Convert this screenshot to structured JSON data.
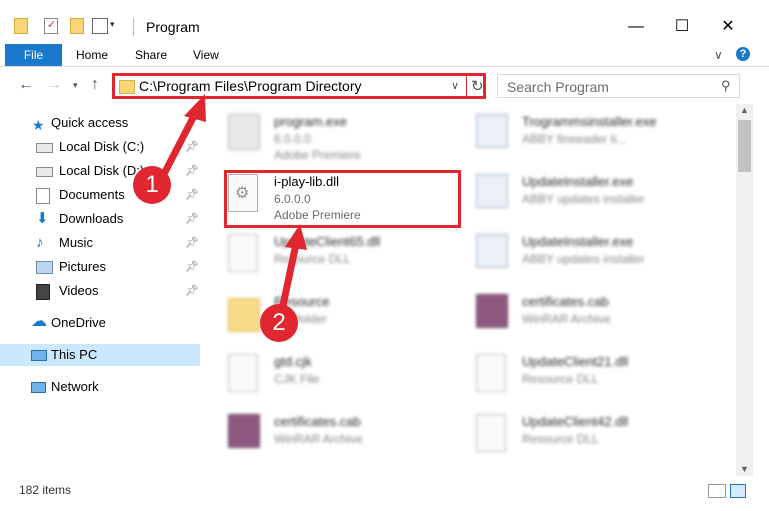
{
  "window": {
    "title": "Program",
    "minimize": "—",
    "maximize": "☐",
    "close": "✕"
  },
  "ribbon": {
    "tabs": [
      "File",
      "Home",
      "Share",
      "View"
    ],
    "help": "?",
    "collapse": "∨"
  },
  "nav": {
    "address": "C:\\Program Files\\Program Directory",
    "search_placeholder": "Search Program"
  },
  "sidebar": {
    "items": [
      {
        "label": "Quick access",
        "icon": "star-icon"
      },
      {
        "label": "Local Disk (C:)",
        "icon": "drive-icon",
        "pinned": true
      },
      {
        "label": "Local Disk (D:)",
        "icon": "drive-icon",
        "pinned": true
      },
      {
        "label": "Documents",
        "icon": "documents-icon",
        "pinned": true
      },
      {
        "label": "Downloads",
        "icon": "downloads-icon",
        "pinned": true
      },
      {
        "label": "Music",
        "icon": "music-icon",
        "pinned": true
      },
      {
        "label": "Pictures",
        "icon": "pictures-icon",
        "pinned": true
      },
      {
        "label": "Videos",
        "icon": "videos-icon",
        "pinned": true
      },
      {
        "label": "OneDrive",
        "icon": "cloud-icon"
      },
      {
        "label": "This PC",
        "icon": "pc-icon",
        "selected": true
      },
      {
        "label": "Network",
        "icon": "network-icon"
      }
    ]
  },
  "files": {
    "left": [
      {
        "name": "program.exe",
        "line1": "6.0.0.0",
        "line2": "Adobe Premiere",
        "icon": "exe-icon"
      },
      {
        "name": "i-play-lib.dll",
        "line1": "6.0.0.0",
        "line2": "Adobe Premiere",
        "icon": "dll-gear-icon"
      },
      {
        "name": "UpdateClient65.dll",
        "line1": "Resource DLL",
        "line2": "",
        "icon": "dll-gear-icon"
      },
      {
        "name": "Resource",
        "line1": "File folder",
        "line2": "",
        "icon": "folder-icon"
      },
      {
        "name": "gtd.cjk",
        "line1": "CJK File",
        "line2": "",
        "icon": "blank-file-icon"
      },
      {
        "name": "certificates.cab",
        "line1": "WinRAR Archive",
        "line2": "",
        "icon": "winrar-icon"
      }
    ],
    "right": [
      {
        "name": "Trogrammsinstaller.exe",
        "line1": "ABBY fineeader ti...",
        "line2": "",
        "icon": "installer-icon"
      },
      {
        "name": "UpdateInstaller.exe",
        "line1": "ABBY updates installer",
        "line2": "",
        "icon": "installer-icon"
      },
      {
        "name": "UpdateInstaller.exe",
        "line1": "ABBY updates installer",
        "line2": "",
        "icon": "installer-icon"
      },
      {
        "name": "certificates.cab",
        "line1": "WinRAR Archive",
        "line2": "",
        "icon": "winrar-icon"
      },
      {
        "name": "UpdateClient21.dll",
        "line1": "Resource DLL",
        "line2": "",
        "icon": "dll-gear-icon"
      },
      {
        "name": "UpdateClient42.dll",
        "line1": "Resource DLL",
        "line2": "",
        "icon": "dll-gear-icon"
      }
    ]
  },
  "status": {
    "count": "182 items"
  },
  "callouts": {
    "badge1": "1",
    "badge2": "2"
  },
  "colors": {
    "accent": "#1979ca",
    "highlight": "#e0262e",
    "selected": "#cce8ff"
  }
}
